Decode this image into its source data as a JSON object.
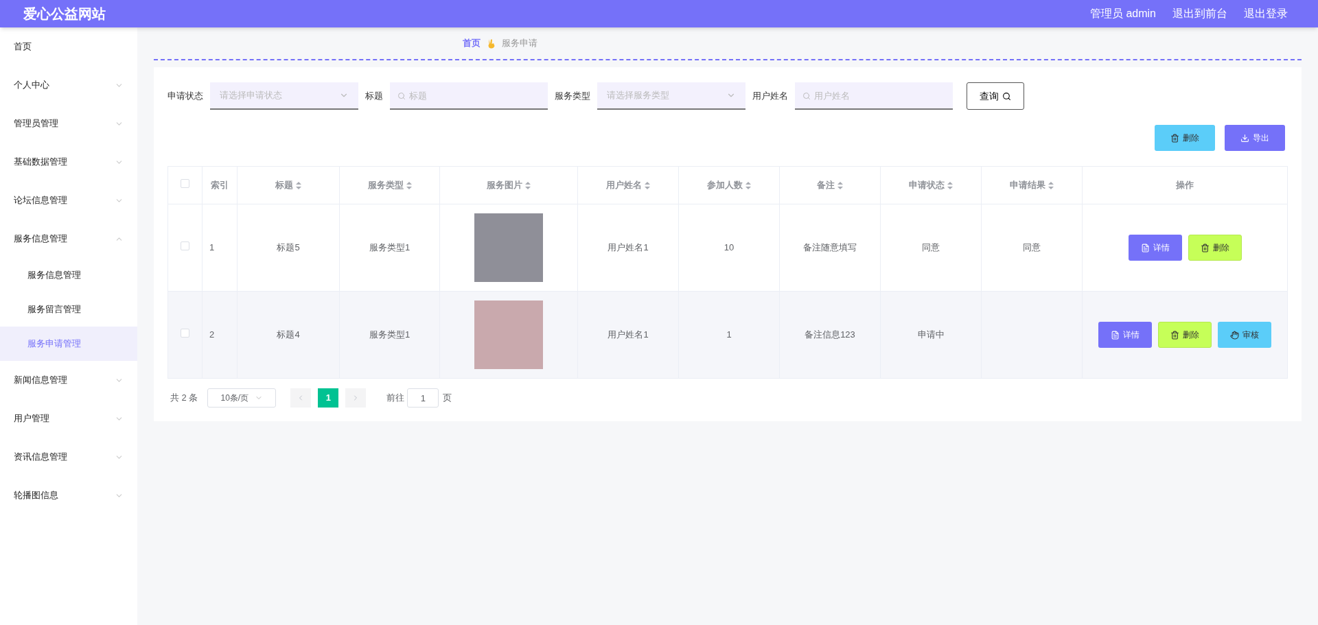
{
  "header": {
    "title": "爱心公益网站",
    "links": [
      "管理员 admin",
      "退出到前台",
      "退出登录"
    ]
  },
  "sidebar": {
    "items": [
      {
        "label": "首页",
        "kind": "link"
      },
      {
        "label": "个人中心",
        "kind": "submenu",
        "expanded": false
      },
      {
        "label": "管理员管理",
        "kind": "submenu",
        "expanded": false
      },
      {
        "label": "基础数据管理",
        "kind": "submenu",
        "expanded": false
      },
      {
        "label": "论坛信息管理",
        "kind": "submenu",
        "expanded": false
      },
      {
        "label": "服务信息管理",
        "kind": "submenu",
        "expanded": true,
        "children": [
          {
            "label": "服务信息管理",
            "selected": false
          },
          {
            "label": "服务留言管理",
            "selected": false
          },
          {
            "label": "服务申请管理",
            "selected": true
          }
        ]
      },
      {
        "label": "新闻信息管理",
        "kind": "submenu",
        "expanded": false
      },
      {
        "label": "用户管理",
        "kind": "submenu",
        "expanded": false
      },
      {
        "label": "资讯信息管理",
        "kind": "submenu",
        "expanded": false
      },
      {
        "label": "轮播图信息",
        "kind": "submenu",
        "expanded": false
      }
    ]
  },
  "breadcrumb": {
    "home": "首页",
    "current": "服务申请"
  },
  "filters": [
    {
      "label": "申请状态",
      "kind": "select",
      "placeholder": "请选择申请状态"
    },
    {
      "label": "标题",
      "kind": "search",
      "placeholder": "标题"
    },
    {
      "label": "服务类型",
      "kind": "select",
      "placeholder": "请选择服务类型"
    },
    {
      "label": "用户姓名",
      "kind": "search",
      "placeholder": "用户姓名"
    }
  ],
  "query_button": "查询",
  "toolbar": [
    {
      "label": "删除",
      "kind": "delete"
    },
    {
      "label": "导出",
      "kind": "export"
    }
  ],
  "table": {
    "header_checkbox": {
      "checked": false
    },
    "columns": [
      {
        "label": "索引",
        "sortable": false
      },
      {
        "label": "标题",
        "sortable": true
      },
      {
        "label": "服务类型",
        "sortable": true
      },
      {
        "label": "服务图片",
        "sortable": true
      },
      {
        "label": "用户姓名",
        "sortable": true
      },
      {
        "label": "参加人数",
        "sortable": true
      },
      {
        "label": "备注",
        "sortable": true
      },
      {
        "label": "申请状态",
        "sortable": true
      },
      {
        "label": "申请结果",
        "sortable": true
      },
      {
        "label": "操作",
        "sortable": false
      }
    ],
    "rows": [
      {
        "checked": false,
        "index": "1",
        "title": "标题5",
        "type": "服务类型1",
        "user": "用户姓名1",
        "count": "10",
        "note": "备注随意填写",
        "status": "同意",
        "result": "同意",
        "actions": [
          {
            "label": "详情",
            "kind": "detail"
          },
          {
            "label": "删除",
            "kind": "delete"
          }
        ]
      },
      {
        "checked": false,
        "index": "2",
        "title": "标题4",
        "type": "服务类型1",
        "user": "用户姓名1",
        "count": "1",
        "note": "备注信息123",
        "status": "申请中",
        "actions": [
          {
            "label": "详情",
            "kind": "detail"
          },
          {
            "label": "删除",
            "kind": "delete"
          },
          {
            "label": "审核",
            "kind": "review"
          }
        ]
      }
    ]
  },
  "pagination": {
    "total": "共 2 条",
    "page_size": "10条/页",
    "pages": [
      {
        "label": "1",
        "selected": true
      }
    ],
    "goto_label": "前往",
    "goto_value": "1",
    "page_suffix": "页"
  }
}
